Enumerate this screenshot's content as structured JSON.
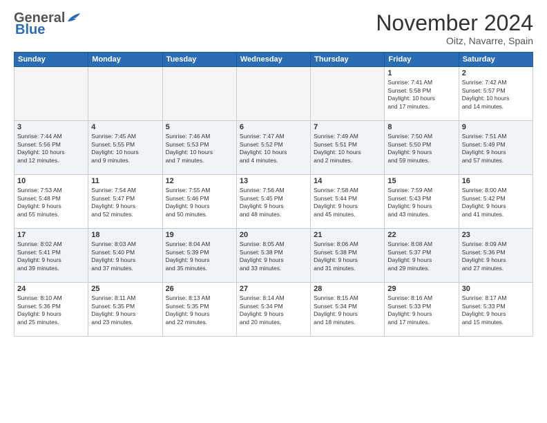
{
  "header": {
    "logo_general": "General",
    "logo_blue": "Blue",
    "month_year": "November 2024",
    "location": "Oitz, Navarre, Spain"
  },
  "weekdays": [
    "Sunday",
    "Monday",
    "Tuesday",
    "Wednesday",
    "Thursday",
    "Friday",
    "Saturday"
  ],
  "weeks": [
    [
      {
        "day": "",
        "info": ""
      },
      {
        "day": "",
        "info": ""
      },
      {
        "day": "",
        "info": ""
      },
      {
        "day": "",
        "info": ""
      },
      {
        "day": "",
        "info": ""
      },
      {
        "day": "1",
        "info": "Sunrise: 7:41 AM\nSunset: 5:58 PM\nDaylight: 10 hours\nand 17 minutes."
      },
      {
        "day": "2",
        "info": "Sunrise: 7:42 AM\nSunset: 5:57 PM\nDaylight: 10 hours\nand 14 minutes."
      }
    ],
    [
      {
        "day": "3",
        "info": "Sunrise: 7:44 AM\nSunset: 5:56 PM\nDaylight: 10 hours\nand 12 minutes."
      },
      {
        "day": "4",
        "info": "Sunrise: 7:45 AM\nSunset: 5:55 PM\nDaylight: 10 hours\nand 9 minutes."
      },
      {
        "day": "5",
        "info": "Sunrise: 7:46 AM\nSunset: 5:53 PM\nDaylight: 10 hours\nand 7 minutes."
      },
      {
        "day": "6",
        "info": "Sunrise: 7:47 AM\nSunset: 5:52 PM\nDaylight: 10 hours\nand 4 minutes."
      },
      {
        "day": "7",
        "info": "Sunrise: 7:49 AM\nSunset: 5:51 PM\nDaylight: 10 hours\nand 2 minutes."
      },
      {
        "day": "8",
        "info": "Sunrise: 7:50 AM\nSunset: 5:50 PM\nDaylight: 9 hours\nand 59 minutes."
      },
      {
        "day": "9",
        "info": "Sunrise: 7:51 AM\nSunset: 5:49 PM\nDaylight: 9 hours\nand 57 minutes."
      }
    ],
    [
      {
        "day": "10",
        "info": "Sunrise: 7:53 AM\nSunset: 5:48 PM\nDaylight: 9 hours\nand 55 minutes."
      },
      {
        "day": "11",
        "info": "Sunrise: 7:54 AM\nSunset: 5:47 PM\nDaylight: 9 hours\nand 52 minutes."
      },
      {
        "day": "12",
        "info": "Sunrise: 7:55 AM\nSunset: 5:46 PM\nDaylight: 9 hours\nand 50 minutes."
      },
      {
        "day": "13",
        "info": "Sunrise: 7:56 AM\nSunset: 5:45 PM\nDaylight: 9 hours\nand 48 minutes."
      },
      {
        "day": "14",
        "info": "Sunrise: 7:58 AM\nSunset: 5:44 PM\nDaylight: 9 hours\nand 45 minutes."
      },
      {
        "day": "15",
        "info": "Sunrise: 7:59 AM\nSunset: 5:43 PM\nDaylight: 9 hours\nand 43 minutes."
      },
      {
        "day": "16",
        "info": "Sunrise: 8:00 AM\nSunset: 5:42 PM\nDaylight: 9 hours\nand 41 minutes."
      }
    ],
    [
      {
        "day": "17",
        "info": "Sunrise: 8:02 AM\nSunset: 5:41 PM\nDaylight: 9 hours\nand 39 minutes."
      },
      {
        "day": "18",
        "info": "Sunrise: 8:03 AM\nSunset: 5:40 PM\nDaylight: 9 hours\nand 37 minutes."
      },
      {
        "day": "19",
        "info": "Sunrise: 8:04 AM\nSunset: 5:39 PM\nDaylight: 9 hours\nand 35 minutes."
      },
      {
        "day": "20",
        "info": "Sunrise: 8:05 AM\nSunset: 5:38 PM\nDaylight: 9 hours\nand 33 minutes."
      },
      {
        "day": "21",
        "info": "Sunrise: 8:06 AM\nSunset: 5:38 PM\nDaylight: 9 hours\nand 31 minutes."
      },
      {
        "day": "22",
        "info": "Sunrise: 8:08 AM\nSunset: 5:37 PM\nDaylight: 9 hours\nand 29 minutes."
      },
      {
        "day": "23",
        "info": "Sunrise: 8:09 AM\nSunset: 5:36 PM\nDaylight: 9 hours\nand 27 minutes."
      }
    ],
    [
      {
        "day": "24",
        "info": "Sunrise: 8:10 AM\nSunset: 5:36 PM\nDaylight: 9 hours\nand 25 minutes."
      },
      {
        "day": "25",
        "info": "Sunrise: 8:11 AM\nSunset: 5:35 PM\nDaylight: 9 hours\nand 23 minutes."
      },
      {
        "day": "26",
        "info": "Sunrise: 8:13 AM\nSunset: 5:35 PM\nDaylight: 9 hours\nand 22 minutes."
      },
      {
        "day": "27",
        "info": "Sunrise: 8:14 AM\nSunset: 5:34 PM\nDaylight: 9 hours\nand 20 minutes."
      },
      {
        "day": "28",
        "info": "Sunrise: 8:15 AM\nSunset: 5:34 PM\nDaylight: 9 hours\nand 18 minutes."
      },
      {
        "day": "29",
        "info": "Sunrise: 8:16 AM\nSunset: 5:33 PM\nDaylight: 9 hours\nand 17 minutes."
      },
      {
        "day": "30",
        "info": "Sunrise: 8:17 AM\nSunset: 5:33 PM\nDaylight: 9 hours\nand 15 minutes."
      }
    ]
  ]
}
